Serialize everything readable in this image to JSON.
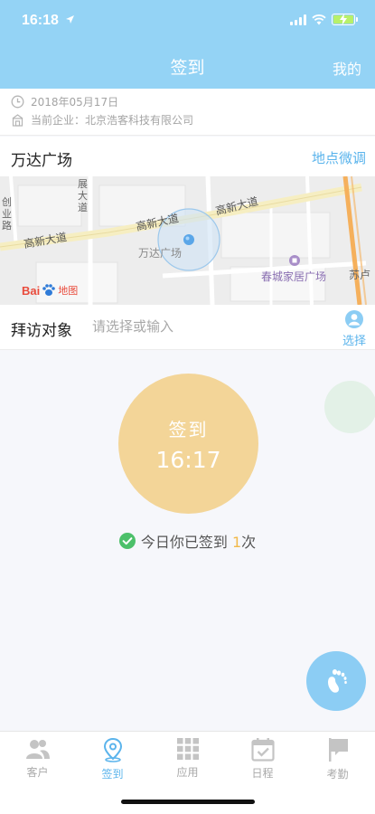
{
  "status_bar": {
    "time": "16:18"
  },
  "nav": {
    "title": "签到",
    "right_label": "我的"
  },
  "info": {
    "date": "2018年05月17日",
    "company": "当前企业：北京浩客科技有限公司"
  },
  "location": {
    "name": "万达广场",
    "adjust_label": "地点微调"
  },
  "map": {
    "roads": [
      "高新大道",
      "高新大道",
      "高新大道",
      "展大道",
      "创业路"
    ],
    "place_label": "万达广场",
    "poi_label": "春城家居广场",
    "edge_label": "苏卢",
    "logo_text": "Bai",
    "logo_text2": "地图"
  },
  "visit": {
    "label": "拜访对象",
    "placeholder": "请选择或输入",
    "select_label": "选择"
  },
  "checkin": {
    "label": "签到",
    "time": "16:17",
    "today_prefix": "今日你已签到",
    "today_count": "1",
    "today_suffix": "次"
  },
  "tabs": [
    {
      "label": "客户",
      "icon": "customers-icon",
      "active": false
    },
    {
      "label": "签到",
      "icon": "location-pin-icon",
      "active": true
    },
    {
      "label": "应用",
      "icon": "grid-icon",
      "active": false
    },
    {
      "label": "日程",
      "icon": "calendar-check-icon",
      "active": false
    },
    {
      "label": "考勤",
      "icon": "flag-icon",
      "active": false
    }
  ],
  "colors": {
    "header": "#94d3f5",
    "accent": "#5bb4ec",
    "checkin_circle": "#f3d598",
    "success": "#4cc06a"
  }
}
